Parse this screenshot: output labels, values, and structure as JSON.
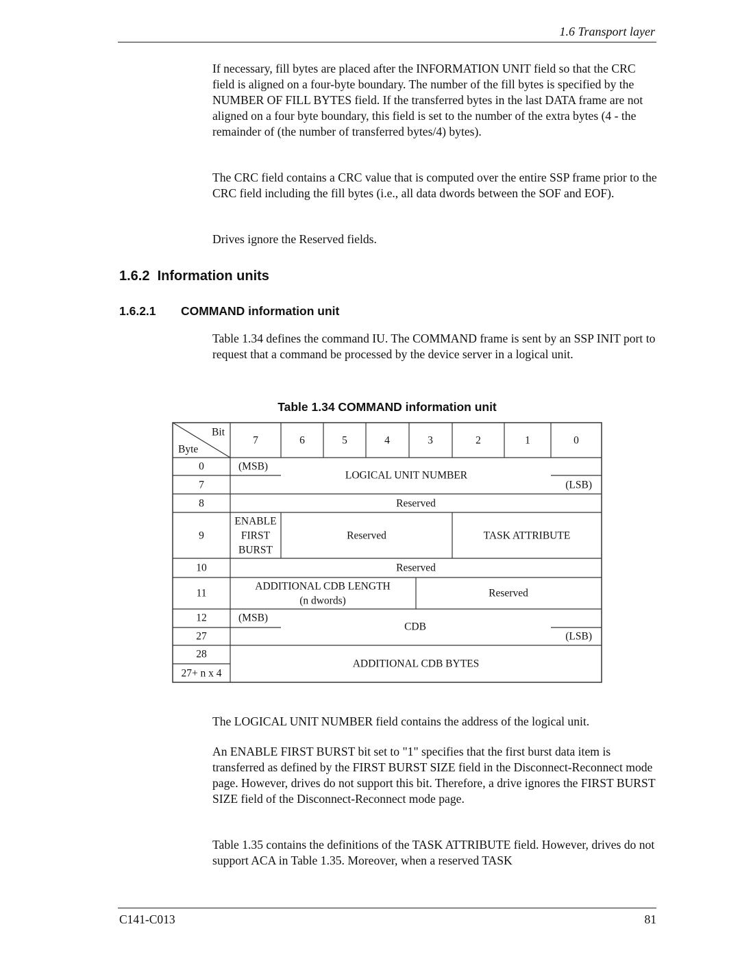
{
  "header": {
    "running_head": "1.6  Transport layer"
  },
  "intro_paragraphs": [
    "If necessary, fill bytes are placed after the INFORMATION UNIT field so that the CRC field is aligned on a four-byte boundary.  The number of the fill bytes is specified by the NUMBER OF FILL BYTES field.  If the transferred bytes in the last DATA frame are not aligned on a four byte boundary, this field is set to the number of the extra bytes (4 - the remainder of (the number of transferred bytes/4) bytes).",
    "The CRC field contains a CRC value that is computed over the entire SSP frame prior to the CRC field including the fill bytes (i.e., all data dwords between the SOF and EOF).",
    "Drives ignore the Reserved fields."
  ],
  "section": {
    "number": "1.6.2",
    "title": "Information units"
  },
  "subsection": {
    "number": "1.6.2.1",
    "title": "COMMAND information unit"
  },
  "subsection_paragraph": "Table 1.34 defines the command IU. The COMMAND frame is sent by an SSP INIT port to request that a command be processed by the device server in a logical unit.",
  "table": {
    "caption": "Table 1.34  COMMAND information unit",
    "corner_bit": "Bit",
    "corner_byte": "Byte",
    "bit_headers": [
      "7",
      "6",
      "5",
      "4",
      "3",
      "2",
      "1",
      "0"
    ],
    "byte_labels": [
      "0",
      "7",
      "8",
      "9",
      "10",
      "11",
      "12",
      "27",
      "28",
      "27+ n x 4"
    ],
    "fields": {
      "lun_msb": "(MSB)",
      "lun": "LOGICAL UNIT NUMBER",
      "lun_lsb": "(LSB)",
      "byte8_reserved": "Reserved",
      "efb_line1": "ENABLE",
      "efb_line2": "FIRST",
      "efb_line3": "BURST",
      "byte9_reserved": "Reserved",
      "task_attribute": "TASK ATTRIBUTE",
      "byte10_reserved": "Reserved",
      "add_cdb_len": "ADDITIONAL CDB LENGTH",
      "add_cdb_len_unit": "(n dwords)",
      "byte11_reserved": "Reserved",
      "cdb_msb": "(MSB)",
      "cdb": "CDB",
      "cdb_lsb": "(LSB)",
      "add_cdb_bytes": "ADDITIONAL CDB BYTES"
    }
  },
  "after_table_paragraphs": [
    "The LOGICAL UNIT NUMBER field contains the address of the logical unit.",
    "An ENABLE FIRST BURST bit set to \"1\" specifies that the first burst data item is transferred as defined by the FIRST BURST SIZE field in the Disconnect-Reconnect mode page.  However, drives do not support this bit.  Therefore, a drive ignores the FIRST BURST SIZE field of the Disconnect-Reconnect mode page.",
    "Table 1.35 contains the definitions of the TASK ATTRIBUTE field.  However, drives do not support ACA in Table 1.35.  Moreover, when a reserved TASK"
  ],
  "footer": {
    "doc_id": "C141-C013",
    "page_number": "81"
  }
}
